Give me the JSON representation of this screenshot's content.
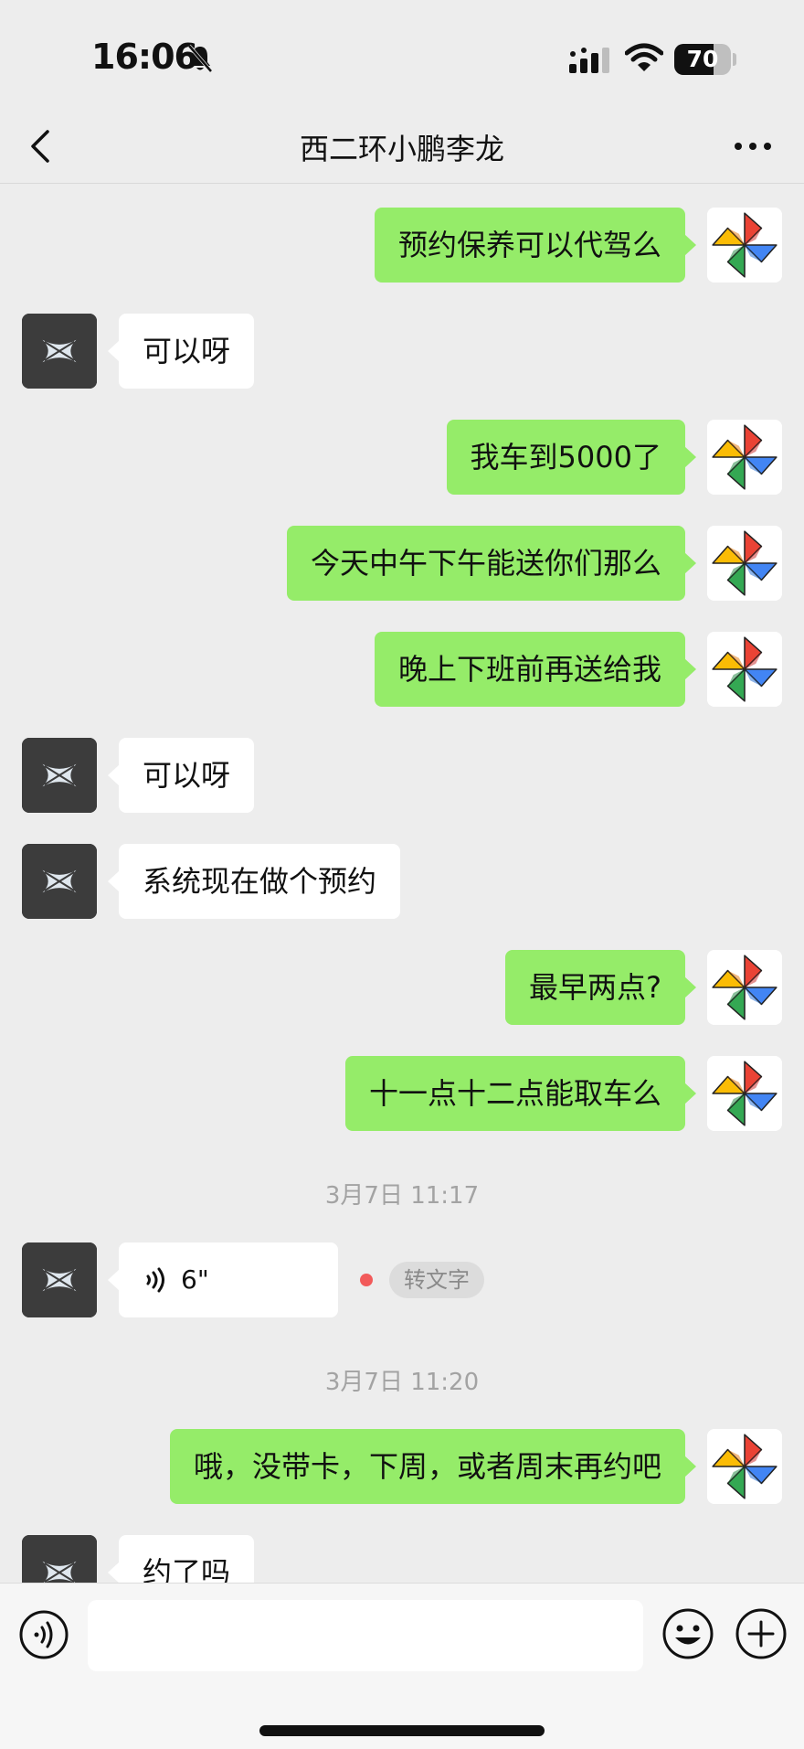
{
  "status_bar": {
    "time": "16:06",
    "battery": "70",
    "battery_level": 0.7
  },
  "header": {
    "title": "西二环小鹏李龙"
  },
  "messages": [
    {
      "side": "right",
      "text": "预约保养可以代驾么"
    },
    {
      "side": "left",
      "text": "可以呀"
    },
    {
      "side": "right",
      "text": "我车到5000了"
    },
    {
      "side": "right",
      "text": "今天中午下午能送你们那么"
    },
    {
      "side": "right",
      "text": "晚上下班前再送给我"
    },
    {
      "side": "left",
      "text": "可以呀"
    },
    {
      "side": "left",
      "text": "系统现在做个预约"
    },
    {
      "side": "right",
      "text": "最早两点?"
    },
    {
      "side": "right",
      "text": "十一点十二点能取车么"
    }
  ],
  "timestamp_1": "3月7日 11:17",
  "voice_message": {
    "duration": "6\"",
    "convert_label": "转文字"
  },
  "timestamp_2": "3月7日 11:20",
  "messages_after": [
    {
      "side": "right",
      "text": "哦，没带卡，下周，或者周末再约吧"
    },
    {
      "side": "left",
      "text": "约了吗"
    }
  ],
  "input": {
    "value": "",
    "placeholder": ""
  },
  "colors": {
    "sent_bubble": "#95ec69",
    "received_bubble": "#ffffff",
    "background": "#ededed",
    "unread_dot": "#f25a5a"
  }
}
